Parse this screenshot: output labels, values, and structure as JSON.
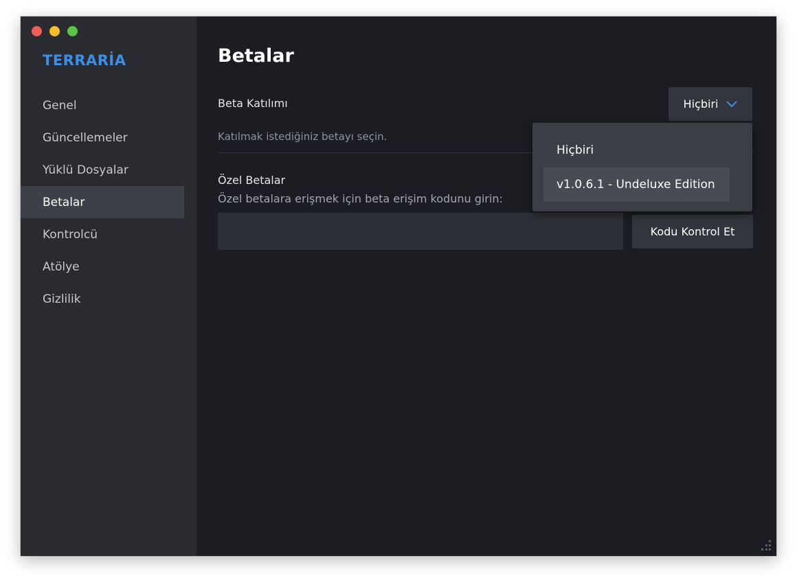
{
  "window": {
    "traffic_lights": [
      "close",
      "minimize",
      "maximize"
    ]
  },
  "sidebar": {
    "app_title": "TERRARİA",
    "items": [
      {
        "label": "Genel",
        "active": false
      },
      {
        "label": "Güncellemeler",
        "active": false
      },
      {
        "label": "Yüklü Dosyalar",
        "active": false
      },
      {
        "label": "Betalar",
        "active": true
      },
      {
        "label": "Kontrolcü",
        "active": false
      },
      {
        "label": "Atölye",
        "active": false
      },
      {
        "label": "Gizlilik",
        "active": false
      }
    ]
  },
  "main": {
    "title": "Betalar",
    "beta_participation": {
      "label": "Beta Katılımı",
      "description": "Katılmak istediğiniz betayı seçin.",
      "selected": "Hiçbiri",
      "options": [
        "Hiçbiri",
        "v1.0.6.1 - Undeluxe Edition"
      ]
    },
    "private_betas": {
      "label": "Özel Betalar",
      "description": "Özel betalara erişmek için beta erişim kodunu girin:",
      "input_value": "",
      "button_label": "Kodu Kontrol Et"
    }
  },
  "colors": {
    "accent": "#3d8fe6",
    "window_bg": "#1b1d23",
    "sidebar_bg": "#2a2b30",
    "active_item_bg": "#3c4149"
  },
  "icons": {
    "dropdown": "chevron-down-icon",
    "resize": "resize-grip-icon"
  }
}
